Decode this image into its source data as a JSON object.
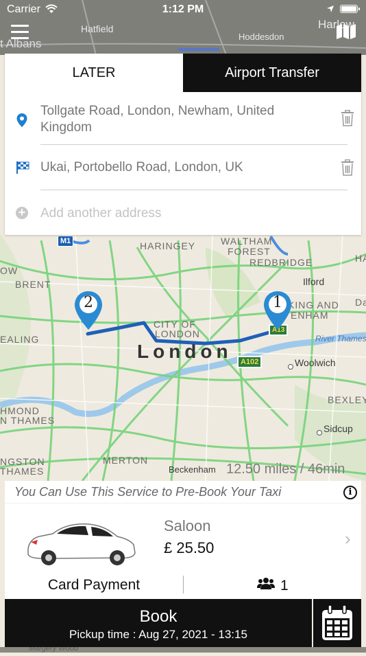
{
  "status_bar": {
    "carrier": "Carrier",
    "time": "1:12 PM"
  },
  "tabs": {
    "later": "LATER",
    "airport": "Airport Transfer"
  },
  "addresses": {
    "pickup": "Tollgate Road, London, Newham, United Kingdom",
    "dropoff": "Ukai, Portobello Road, London, UK",
    "add_placeholder": "Add another address"
  },
  "map": {
    "labels": {
      "st_albans": "t Albans",
      "hatfield": "Hatfield",
      "hoddesdon": "Hoddesdon",
      "harlow": "Harlow",
      "haringey": "HARINGEY",
      "walthamstow": "WALTHAM",
      "forest": "FOREST",
      "redbridge": "REDBRIDGE",
      "ilford": "Ilford",
      "brent": "BRENT",
      "barking": "KING AND",
      "dagenham": "ENHAM",
      "city": "CITY OF",
      "city2": "LONDON",
      "london": "London",
      "ealing": "EALING",
      "woolwich": "Woolwich",
      "bexley": "BEXLEY",
      "richmond": "HMOND",
      "thames": "N THAMES",
      "sidcup": "Sidcup",
      "merton": "MERTON",
      "kingston": "NGSTON",
      "thames2": "THAMES",
      "beckenham": "Beckenham",
      "river": "River Thames",
      "da": "Da",
      "ha": "HA",
      "ow": "OW",
      "margery": "Margery Wood"
    },
    "roads": {
      "m1": "M1",
      "a102": "A102",
      "a13": "A13"
    },
    "markers": [
      "1",
      "2"
    ],
    "route_info": "12.50 miles / 46min"
  },
  "panel": {
    "prebook": "You Can Use This Service to Pre-Book Your Taxi",
    "vehicle": {
      "name": "Saloon",
      "price": "£ 25.50"
    },
    "payment": "Card Payment",
    "passengers": "1"
  },
  "book": {
    "label": "Book",
    "pickup_time": "Pickup time : Aug 27, 2021 - 13:15"
  },
  "colors": {
    "route": "#1f5fb8",
    "marker": "#2a8bd3",
    "dark": "#111111"
  },
  "icons": [
    "menu-icon",
    "map-icon",
    "location-pin-icon",
    "checkered-flag-icon",
    "trash-icon",
    "plus-circle-icon",
    "info-icon",
    "chevron-right-icon",
    "users-icon",
    "calendar-icon",
    "car-image"
  ]
}
